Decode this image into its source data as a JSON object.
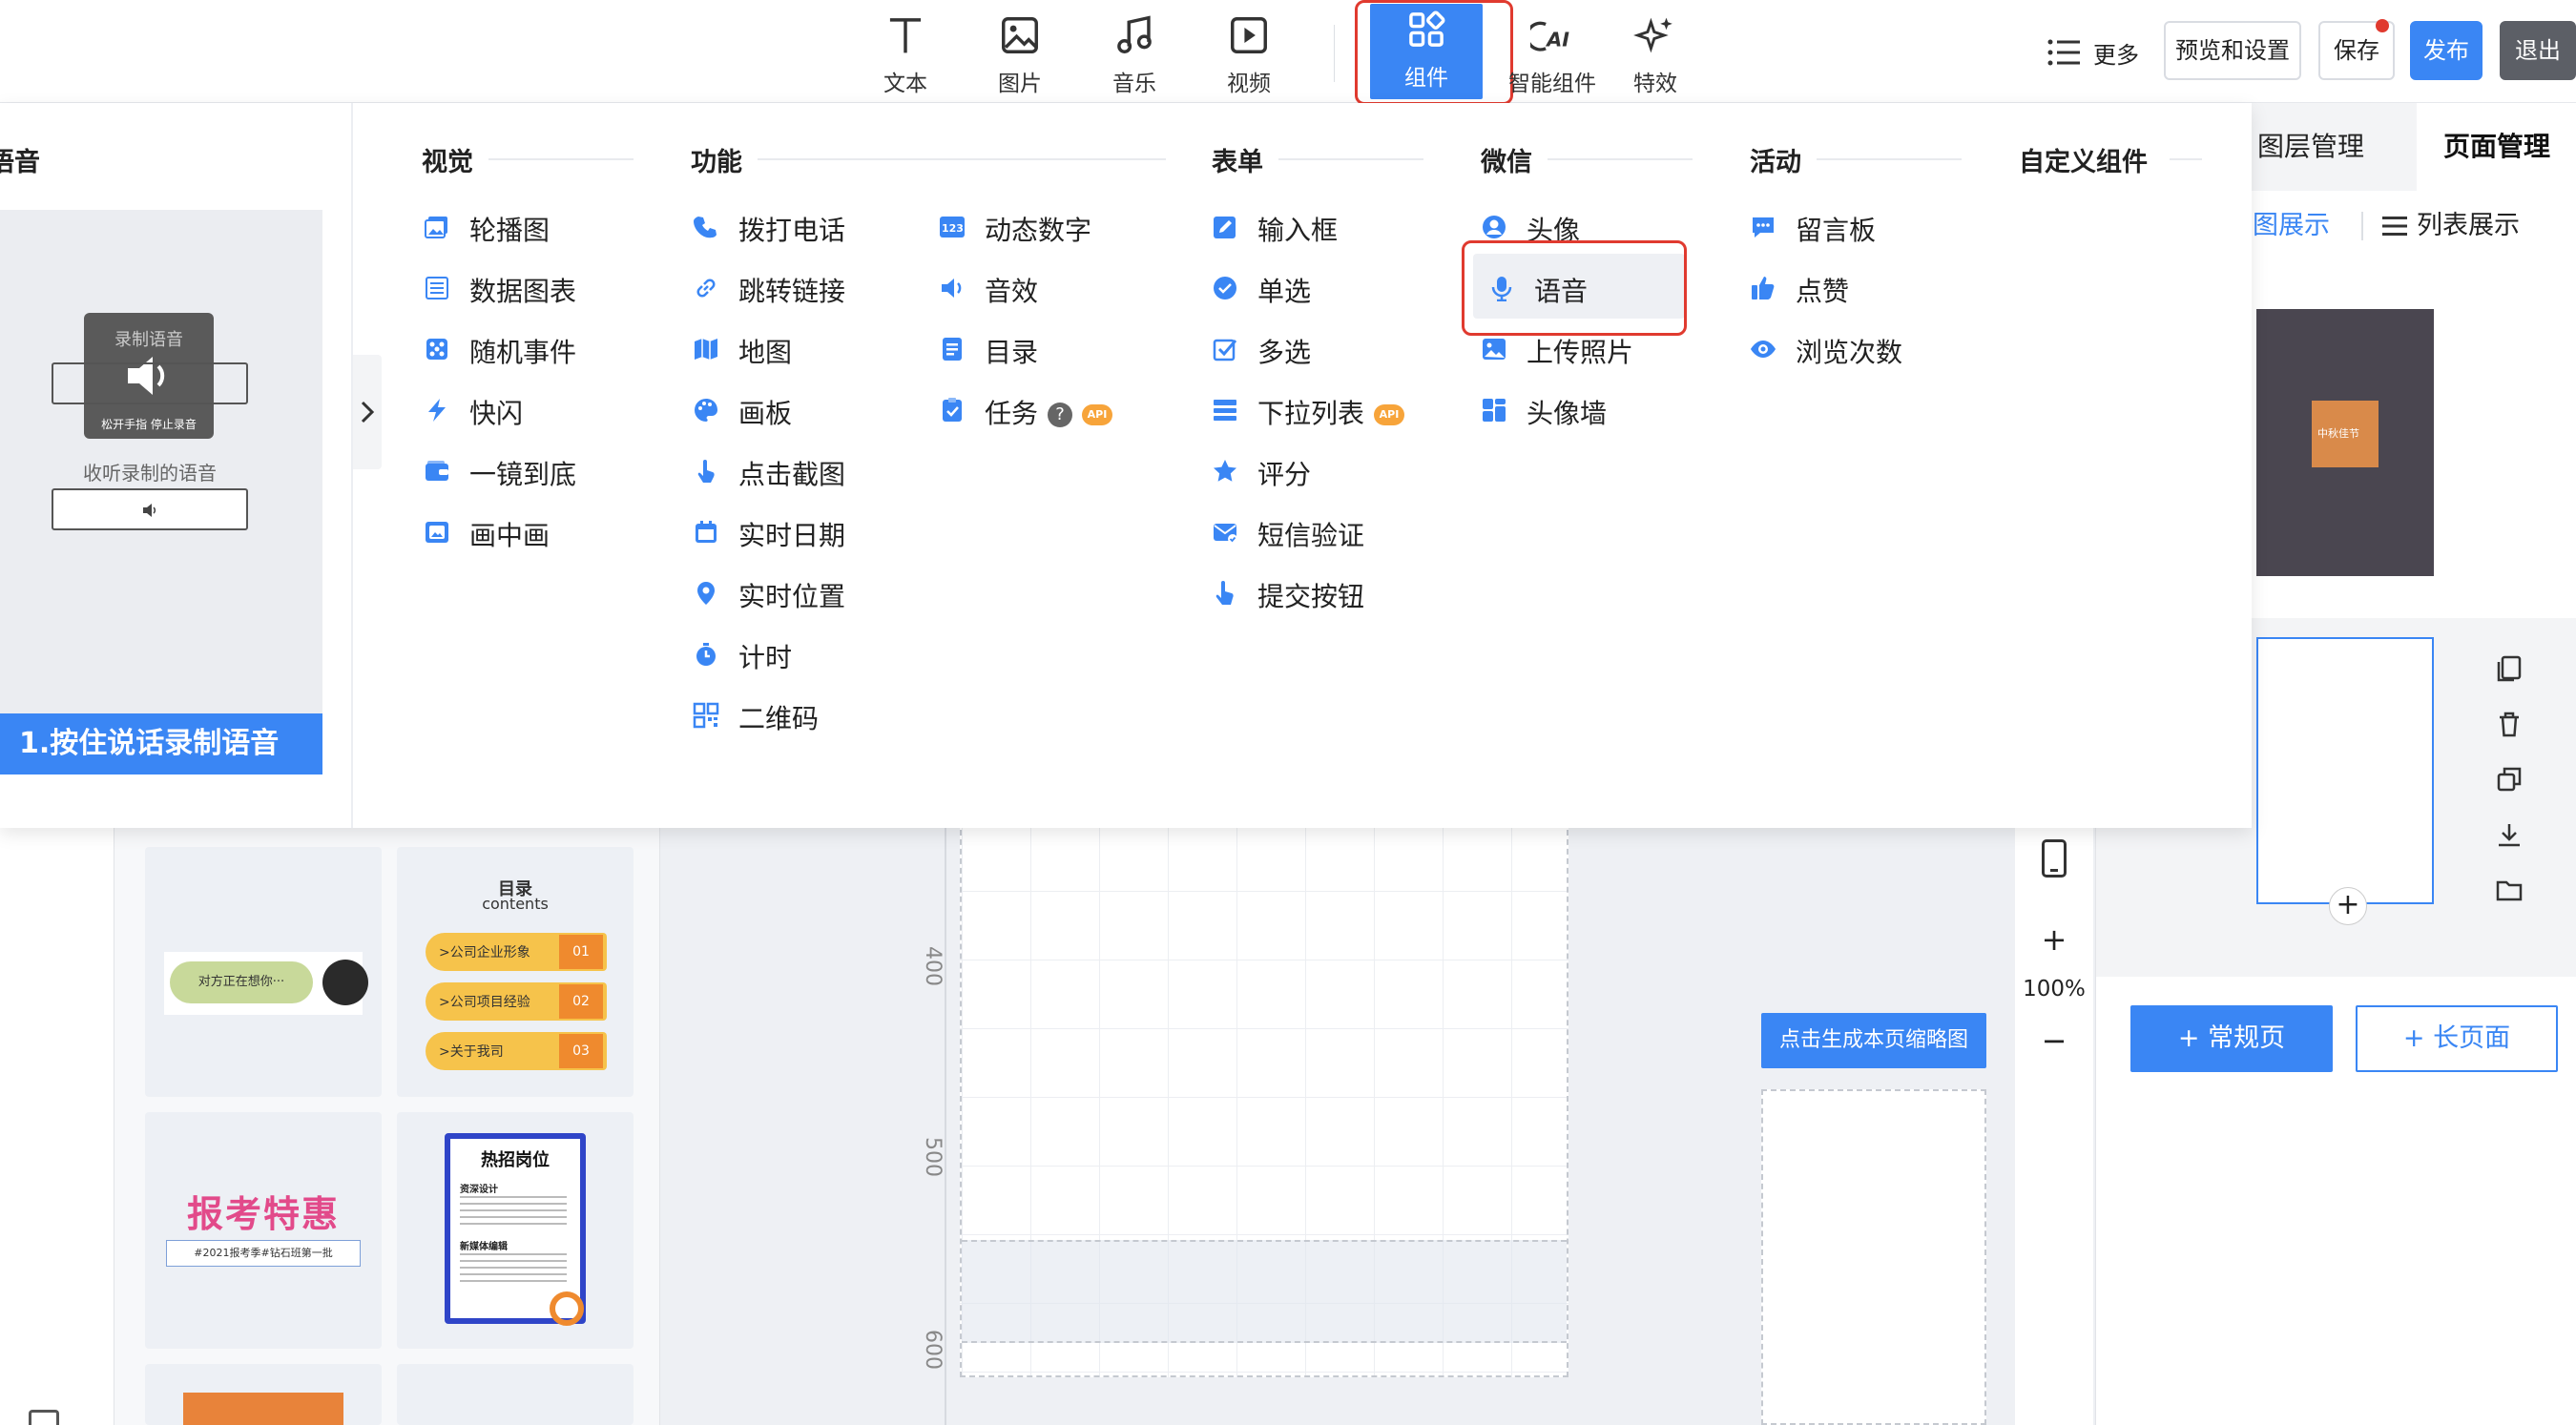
{
  "toolbar": {
    "tools": [
      "文本",
      "图片",
      "音乐",
      "视频",
      "组件",
      "智能组件",
      "特效"
    ],
    "more_label": "更多",
    "preview_label": "预览和设置",
    "save_label": "保存",
    "publish_label": "发布",
    "exit_label": "退出"
  },
  "dropdown": {
    "preview": {
      "title": "语音",
      "record_label": "录制语音",
      "release_hint": "松开手指 停止录音",
      "listen_label": "收听录制的语音",
      "step_label": "1.按住说话录制语音"
    },
    "columns": [
      {
        "title": "视觉",
        "items": [
          "轮播图",
          "数据图表",
          "随机事件",
          "快闪",
          "一镜到底",
          "画中画"
        ]
      },
      {
        "title": "功能",
        "items": [
          "拨打电话",
          "跳转链接",
          "地图",
          "画板",
          "点击截图",
          "实时日期",
          "实时位置",
          "计时",
          "二维码"
        ]
      },
      {
        "title": "",
        "items": [
          "动态数字",
          "音效",
          "目录",
          "任务"
        ]
      },
      {
        "title": "表单",
        "items": [
          "输入框",
          "单选",
          "多选",
          "下拉列表",
          "评分",
          "短信验证",
          "提交按钮"
        ]
      },
      {
        "title": "微信",
        "items": [
          "头像",
          "语音",
          "上传照片",
          "头像墙"
        ]
      },
      {
        "title": "活动",
        "items": [
          "留言板",
          "点赞",
          "浏览次数"
        ]
      },
      {
        "title": "自定义组件",
        "items": []
      }
    ],
    "api_badge": "API"
  },
  "left_panel": {
    "thumb_chat": "对方正在想你···",
    "thumb_toc_title": "目录",
    "thumb_toc_sub": "contents",
    "thumb_toc_rows": [
      {
        "text": ">公司企业形象",
        "num": "01"
      },
      {
        "text": ">公司项目经验",
        "num": "02"
      },
      {
        "text": ">关于我司",
        "num": "03"
      }
    ],
    "thumb_exam_big": "报考特惠",
    "thumb_exam_small": "#2021报考季#钻石班第一批",
    "thumb_job_title": "热招岗位",
    "thumb_job_sub1": "资深设计",
    "thumb_job_sub2": "新媒体编辑"
  },
  "canvas": {
    "ruler_labels": [
      "400",
      "500",
      "600"
    ],
    "thumb_button": "点击生成本页缩略图"
  },
  "zoom": {
    "level": "100%",
    "plus": "+",
    "minus": "−"
  },
  "right_panel": {
    "tab_layers": "图层管理",
    "tab_pages": "页面管理",
    "view_image": "图展示",
    "view_list": "列表展示",
    "page_thumb_text": "中秋佳节",
    "add_normal": "+ 常规页",
    "add_long": "+ 长页面"
  },
  "colors": {
    "accent": "#3a86f4",
    "highlight": "#e03a2f",
    "api": "#f7a43a"
  }
}
